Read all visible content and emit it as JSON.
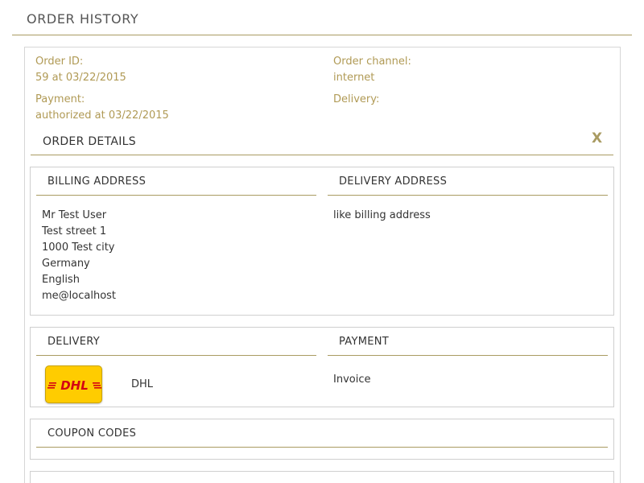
{
  "page": {
    "title": "ORDER HISTORY"
  },
  "order": {
    "id_label": "Order ID:",
    "id_value": "59 at 03/22/2015",
    "channel_label": "Order channel:",
    "channel_value": "internet",
    "payment_label": "Payment:",
    "payment_value": "authorized at 03/22/2015",
    "delivery_label": "Delivery:"
  },
  "details": {
    "title": "ORDER DETAILS",
    "close_label": "X",
    "billing": {
      "title": "BILLING ADDRESS",
      "lines": [
        "Mr Test User",
        "Test street 1",
        "1000 Test city",
        "Germany",
        "English",
        "me@localhost"
      ]
    },
    "delivery_address": {
      "title": "DELIVERY ADDRESS",
      "text": "like billing address"
    },
    "delivery": {
      "title": "DELIVERY",
      "carrier_logo_text": "DHL",
      "carrier": "DHL"
    },
    "payment": {
      "title": "PAYMENT",
      "method": "Invoice"
    },
    "coupons": {
      "title": "COUPON CODES"
    }
  },
  "colors": {
    "accent_gold": "#a99b62",
    "label_gold": "#b09a55",
    "dhl_yellow": "#ffcc00",
    "dhl_red": "#d40511"
  },
  "icons": {
    "carrier_logo": "dhl-logo-icon",
    "close": "close-icon"
  }
}
